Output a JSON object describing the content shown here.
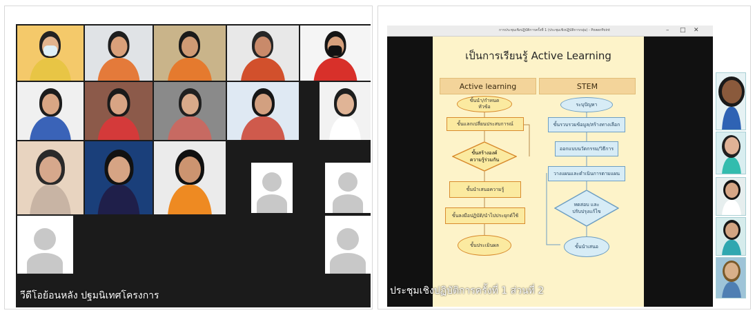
{
  "left_panel": {
    "caption": "วีดีโอย้อนหลัง ปฐมนิเทศโครงการ",
    "tiles": [
      {
        "name": "participant-tile-1",
        "bg": "#f4c96a",
        "shirt": "#e8c545",
        "skin": "#e2b48e",
        "hair": "#222222"
      },
      {
        "name": "participant-tile-2",
        "bg": "#e0e3e6",
        "shirt": "#e47a3a",
        "skin": "#d9a07a",
        "hair": "#1e1e1e"
      },
      {
        "name": "participant-tile-3",
        "bg": "#c9b48a",
        "shirt": "#e57a2e",
        "skin": "#cf9a74",
        "hair": "#1a1a1a"
      },
      {
        "name": "participant-tile-4",
        "bg": "#e8e8e8",
        "shirt": "#d2502c",
        "skin": "#c98a6a",
        "hair": "#262626"
      },
      {
        "name": "participant-tile-5",
        "bg": "#f5f5f5",
        "shirt": "#d8302a",
        "skin": "#d6a07c",
        "hair": "#151515"
      },
      {
        "name": "participant-tile-6",
        "bg": "#f0f0f0",
        "shirt": "#3a63b8",
        "skin": "#d9a684",
        "hair": "#1c1c1c"
      },
      {
        "name": "participant-tile-7",
        "bg": "#8c5a4a",
        "shirt": "#d43a3a",
        "skin": "#d8a484",
        "hair": "#1a1a1a"
      },
      {
        "name": "participant-tile-8",
        "bg": "#8a8a8a",
        "shirt": "#c76a62",
        "skin": "#d9aa8a",
        "hair": "#202020"
      },
      {
        "name": "participant-tile-9",
        "bg": "#dfe9f3",
        "shirt": "#cf5a4c",
        "skin": "#d2a080",
        "hair": "#161616"
      },
      {
        "name": "participant-tile-10",
        "bg": "#f2f2f2",
        "shirt": "#ffffff",
        "skin": "#e0b496",
        "hair": "#1e1e1e"
      },
      {
        "name": "participant-tile-11",
        "bg": "#e8d4c0",
        "shirt": "#c8b4a4",
        "skin": "#d6a88c",
        "hair": "#2a2a2a"
      },
      {
        "name": "participant-tile-12",
        "bg": "#1a3f7a",
        "shirt": "#1f1f4a",
        "skin": "#d6a484",
        "hair": "#121212"
      },
      {
        "name": "participant-tile-13",
        "bg": "#ebebeb",
        "shirt": "#ee8a22",
        "skin": "#cc9470",
        "hair": "#101010"
      }
    ]
  },
  "right_panel": {
    "window_title": "การประชุมเชิงปฏิบัติการครั้งที่ 1 (ประชุมเชิงปฏิบัติการกลุ่ม) - PowerPoint",
    "window_controls": [
      "–",
      "□",
      "✕"
    ],
    "slide_title": "เป็นการเรียนรู้ Active Learning",
    "columns": [
      "Active learning",
      "STEM"
    ],
    "active_learning_steps": [
      "ขั้นนำ/กำหนด\nหัวข้อ",
      "ขั้นแลกเปลี่ยนประสบการณ์",
      "ขั้นสร้างองค์\nความรู้ร่วมกัน",
      "ขั้นนำเสนอความรู้",
      "ขั้นลงมือปฏิบัติ/นำไปประยุกต์ใช้",
      "ขั้นประเมินผล"
    ],
    "stem_steps": [
      "ระบุปัญหา",
      "ขั้นรวบรวมข้อมูล/สร้างทางเลือก",
      "ออกแบบนวัตกรรม/วิธีการ",
      "วางแผนและดำเนินการตามแผน",
      "ทดสอบ และ\nปรับปรุงแก้ไข",
      "ขั้นนำเสนอ"
    ],
    "caption": "ประชุมเชิงปฏิบัติการครั้งที่ 1 ส่วนที่ 2",
    "sidebar_thumbnails": [
      {
        "name": "side-participant-1",
        "shirt": "#2f63b4",
        "skin": "#8a5a3c",
        "hair": "#1a1a1a",
        "bg": "#e6f2f4"
      },
      {
        "name": "side-participant-2",
        "shirt": "#33bcae",
        "skin": "#e0b296",
        "hair": "#202020",
        "bg": "#d9eef0"
      },
      {
        "name": "side-participant-3",
        "shirt": "#ffffff",
        "skin": "#d6a686",
        "hair": "#141414",
        "bg": "#e6eeee"
      },
      {
        "name": "side-participant-4",
        "shirt": "#2fa7b0",
        "skin": "#d2a482",
        "hair": "#181818",
        "bg": "#d6ecec"
      },
      {
        "name": "side-participant-5",
        "shirt": "#4f7fb3",
        "skin": "#d8b08a",
        "hair": "#7a5a2a",
        "bg": "#9ec4d8"
      }
    ]
  }
}
